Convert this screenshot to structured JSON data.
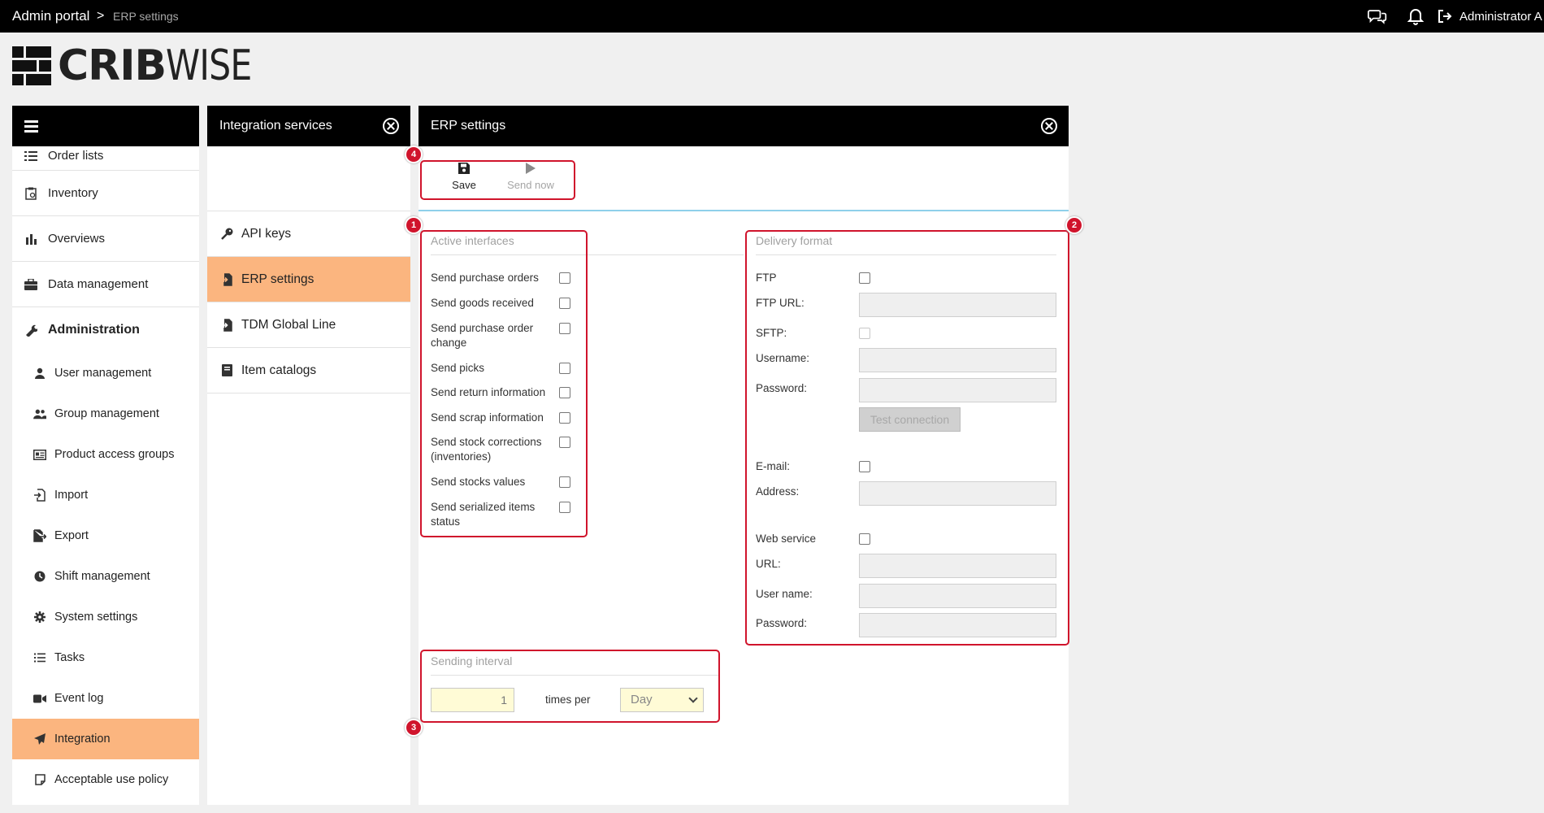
{
  "topbar": {
    "crumb_root": "Admin portal",
    "crumb_sep": ">",
    "crumb_current": "ERP settings",
    "user": "Administrator A"
  },
  "logo": {
    "bold": "CRIB",
    "light": "WISE"
  },
  "nav": {
    "items": [
      {
        "label": "Order lists",
        "icon": "list-icon"
      },
      {
        "label": "Inventory",
        "icon": "clipboard-icon"
      },
      {
        "label": "Overviews",
        "icon": "bar-chart-icon"
      },
      {
        "label": "Data management",
        "icon": "briefcase-icon"
      },
      {
        "label": "Administration",
        "icon": "wrench-icon"
      }
    ],
    "sub": [
      {
        "label": "User management",
        "icon": "user-icon"
      },
      {
        "label": "Group management",
        "icon": "users-icon"
      },
      {
        "label": "Product access groups",
        "icon": "id-card-icon"
      },
      {
        "label": "Import",
        "icon": "file-import-icon"
      },
      {
        "label": "Export",
        "icon": "file-export-icon"
      },
      {
        "label": "Shift management",
        "icon": "clock-icon"
      },
      {
        "label": "System settings",
        "icon": "gear-icon"
      },
      {
        "label": "Tasks",
        "icon": "tasks-icon"
      },
      {
        "label": "Event log",
        "icon": "video-icon"
      },
      {
        "label": "Integration",
        "icon": "paper-plane-icon"
      },
      {
        "label": "Acceptable use policy",
        "icon": "document-icon"
      }
    ]
  },
  "integration_panel": {
    "title": "Integration services",
    "items": [
      {
        "label": "API keys",
        "icon": "key-icon"
      },
      {
        "label": "ERP settings",
        "icon": "file-import-icon"
      },
      {
        "label": "TDM Global Line",
        "icon": "file-import-icon"
      },
      {
        "label": "Item catalogs",
        "icon": "book-icon"
      }
    ]
  },
  "erp_panel": {
    "title": "ERP settings",
    "toolbar": {
      "save": "Save",
      "send_now": "Send now"
    },
    "badges": {
      "b1": "1",
      "b2": "2",
      "b3": "3",
      "b4": "4"
    },
    "active_interfaces": {
      "title": "Active interfaces",
      "items": [
        {
          "label": "Send purchase orders",
          "checked": false
        },
        {
          "label": "Send goods received",
          "checked": false
        },
        {
          "label": "Send purchase order change",
          "checked": false
        },
        {
          "label": "Send picks",
          "checked": false
        },
        {
          "label": "Send return information",
          "checked": false
        },
        {
          "label": "Send scrap information",
          "checked": false
        },
        {
          "label": "Send stock corrections (inventories)",
          "checked": false
        },
        {
          "label": "Send stocks values",
          "checked": false
        },
        {
          "label": "Send serialized items status",
          "checked": false
        }
      ]
    },
    "delivery_format": {
      "title": "Delivery format",
      "ftp": "FTP",
      "ftp_url": "FTP URL:",
      "sftp": "SFTP:",
      "username": "Username:",
      "password": "Password:",
      "test_connection": "Test connection",
      "email": "E-mail:",
      "address": "Address:",
      "web_service": "Web service",
      "url": "URL:",
      "user_name": "User name:",
      "ws_password": "Password:"
    },
    "sending_interval": {
      "title": "Sending interval",
      "value": "1",
      "times_per": "times per",
      "period": "Day"
    }
  }
}
